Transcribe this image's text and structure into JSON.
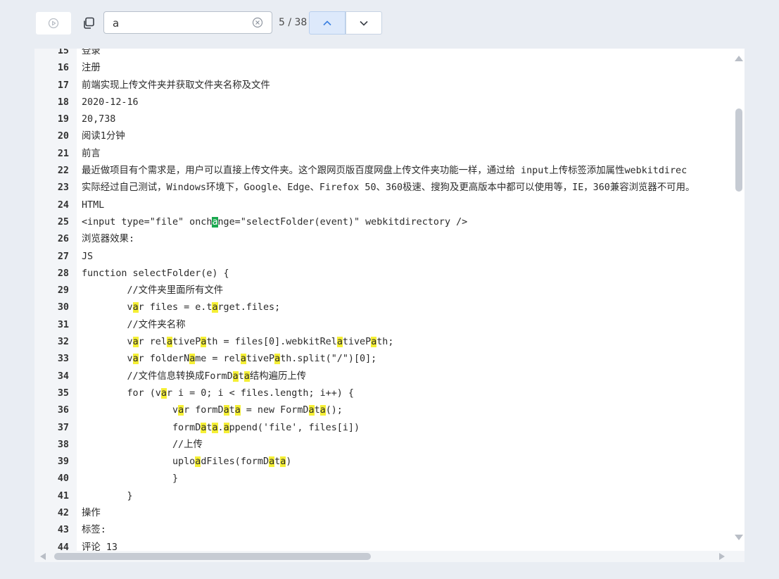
{
  "toolbar": {
    "run_icon": "play-circle-icon",
    "copy_icon": "copy-icon"
  },
  "search": {
    "value": "a",
    "clear_icon": "clear-circle-icon",
    "match_count": "5 / 38",
    "prev_icon": "chevron-up-icon",
    "next_icon": "chevron-down-icon"
  },
  "colors": {
    "match_highlight": "#f5ef35",
    "current_match": "#1aa84f",
    "active_nav": "#dde9fb"
  },
  "editor": {
    "lines": [
      {
        "num": "15",
        "segs": [
          {
            "t": "登录"
          }
        ]
      },
      {
        "num": "16",
        "segs": [
          {
            "t": "注册"
          }
        ]
      },
      {
        "num": "17",
        "segs": [
          {
            "t": "前端实现上传文件夹并获取文件夹名称及文件"
          }
        ]
      },
      {
        "num": "18",
        "segs": [
          {
            "t": "2020-12-16"
          }
        ]
      },
      {
        "num": "19",
        "segs": [
          {
            "t": "20,738"
          }
        ]
      },
      {
        "num": "20",
        "segs": [
          {
            "t": "阅读1分钟"
          }
        ]
      },
      {
        "num": "21",
        "segs": [
          {
            "t": "前言"
          }
        ]
      },
      {
        "num": "22",
        "segs": [
          {
            "t": "最近做项目有个需求是，用户可以直接上传文件夹。这个跟网页版百度网盘上传文件夹功能一样，通过给 input上传标签添加属性webkitdirec"
          }
        ]
      },
      {
        "num": "23",
        "segs": [
          {
            "t": "实际经过自己测试，Windows环境下，Google、Edge、Firefox 50、360极速、搜狗及更高版本中都可以使用等，IE，360兼容浏览器不可用。"
          }
        ]
      },
      {
        "num": "24",
        "segs": [
          {
            "t": "HTML"
          }
        ]
      },
      {
        "num": "25",
        "segs": [
          {
            "t": "<input type=\"file\" onch"
          },
          {
            "t": "a",
            "h": "cur"
          },
          {
            "t": "nge=\"selectFolder(event)\" webkitdirectory />"
          }
        ]
      },
      {
        "num": "26",
        "segs": [
          {
            "t": "浏览器效果:"
          }
        ]
      },
      {
        "num": "27",
        "segs": [
          {
            "t": "JS"
          }
        ]
      },
      {
        "num": "28",
        "segs": [
          {
            "t": "function selectFolder(e) {"
          }
        ]
      },
      {
        "num": "29",
        "segs": [
          {
            "t": "        //文件夹里面所有文件"
          }
        ]
      },
      {
        "num": "30",
        "segs": [
          {
            "t": "        v"
          },
          {
            "t": "a",
            "h": "m"
          },
          {
            "t": "r files = e.t"
          },
          {
            "t": "a",
            "h": "m"
          },
          {
            "t": "rget.files;"
          }
        ]
      },
      {
        "num": "31",
        "segs": [
          {
            "t": "        //文件夹名称"
          }
        ]
      },
      {
        "num": "32",
        "segs": [
          {
            "t": "        v"
          },
          {
            "t": "a",
            "h": "m"
          },
          {
            "t": "r rel"
          },
          {
            "t": "a",
            "h": "m"
          },
          {
            "t": "tiveP"
          },
          {
            "t": "a",
            "h": "m"
          },
          {
            "t": "th = files[0].webkitRel"
          },
          {
            "t": "a",
            "h": "m"
          },
          {
            "t": "tiveP"
          },
          {
            "t": "a",
            "h": "m"
          },
          {
            "t": "th;"
          }
        ]
      },
      {
        "num": "33",
        "segs": [
          {
            "t": "        v"
          },
          {
            "t": "a",
            "h": "m"
          },
          {
            "t": "r folderN"
          },
          {
            "t": "a",
            "h": "m"
          },
          {
            "t": "me = rel"
          },
          {
            "t": "a",
            "h": "m"
          },
          {
            "t": "tiveP"
          },
          {
            "t": "a",
            "h": "m"
          },
          {
            "t": "th.split(\"/\")[0];"
          }
        ]
      },
      {
        "num": "34",
        "segs": [
          {
            "t": "        //文件信息转换成FormD"
          },
          {
            "t": "a",
            "h": "m"
          },
          {
            "t": "t"
          },
          {
            "t": "a",
            "h": "m"
          },
          {
            "t": "结构遍历上传"
          }
        ]
      },
      {
        "num": "35",
        "segs": [
          {
            "t": "        for (v"
          },
          {
            "t": "a",
            "h": "m"
          },
          {
            "t": "r i = 0; i < files.length; i++) {"
          }
        ]
      },
      {
        "num": "36",
        "segs": [
          {
            "t": "                v"
          },
          {
            "t": "a",
            "h": "m"
          },
          {
            "t": "r formD"
          },
          {
            "t": "a",
            "h": "m"
          },
          {
            "t": "t"
          },
          {
            "t": "a",
            "h": "m"
          },
          {
            "t": " = new FormD"
          },
          {
            "t": "a",
            "h": "m"
          },
          {
            "t": "t"
          },
          {
            "t": "a",
            "h": "m"
          },
          {
            "t": "();"
          }
        ]
      },
      {
        "num": "37",
        "segs": [
          {
            "t": "                formD"
          },
          {
            "t": "a",
            "h": "m"
          },
          {
            "t": "t"
          },
          {
            "t": "a",
            "h": "m"
          },
          {
            "t": "."
          },
          {
            "t": "a",
            "h": "m"
          },
          {
            "t": "ppend('file', files[i])"
          }
        ]
      },
      {
        "num": "38",
        "segs": [
          {
            "t": "                //上传"
          }
        ]
      },
      {
        "num": "39",
        "segs": [
          {
            "t": "                uplo"
          },
          {
            "t": "a",
            "h": "m"
          },
          {
            "t": "dFiles(formD"
          },
          {
            "t": "a",
            "h": "m"
          },
          {
            "t": "t"
          },
          {
            "t": "a",
            "h": "m"
          },
          {
            "t": ")"
          }
        ]
      },
      {
        "num": "40",
        "segs": [
          {
            "t": "                }"
          }
        ]
      },
      {
        "num": "41",
        "segs": [
          {
            "t": "        }"
          }
        ]
      },
      {
        "num": "42",
        "segs": [
          {
            "t": "操作"
          }
        ]
      },
      {
        "num": "43",
        "segs": [
          {
            "t": "标签:"
          }
        ]
      },
      {
        "num": "44",
        "segs": [
          {
            "t": "评论 13"
          }
        ]
      }
    ]
  }
}
